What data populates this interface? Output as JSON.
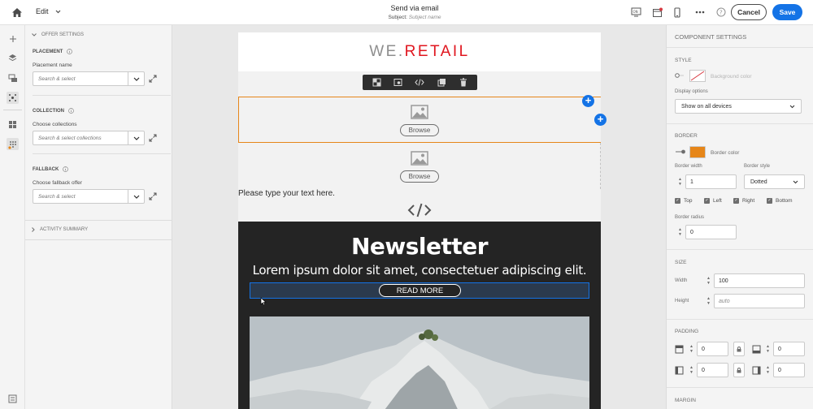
{
  "topbar": {
    "edit_label": "Edit",
    "title": "Send via email",
    "subject_label": "Subject:",
    "subject_placeholder": "Subject name",
    "cancel_label": "Cancel",
    "save_label": "Save",
    "accent": "#1473e6"
  },
  "rail": {
    "icons": [
      "add-icon",
      "layers-icon",
      "fragments-icon",
      "assets-icon",
      "components-icon",
      "offers-icon",
      "settings-bottom-icon"
    ]
  },
  "left_panel": {
    "offer_settings": "OFFER SETTINGS",
    "placement": {
      "heading": "PLACEMENT",
      "label": "Placement name",
      "placeholder": "Search & select"
    },
    "collection": {
      "heading": "COLLECTION",
      "label": "Choose collections",
      "placeholder": "Search & select collections"
    },
    "fallback": {
      "heading": "FALLBACK",
      "label": "Choose fallback offer",
      "placeholder": "Search & select"
    },
    "activity_summary": "ACTIVITY SUMMARY"
  },
  "email": {
    "logo_left": "WE.",
    "logo_right": "RETAIL",
    "browse_label": "Browse",
    "text_placeholder": "Please type your text here.",
    "newsletter_title": "Newsletter",
    "newsletter_subtitle": "Lorem ipsum dolor sit amet, consectetuer adipiscing elit.",
    "read_more": "READ MORE",
    "toolbar_icons": [
      "select-parent-icon",
      "personalize-icon",
      "code-icon",
      "duplicate-icon",
      "delete-icon"
    ]
  },
  "right_panel": {
    "title": "COMPONENT SETTINGS",
    "style": {
      "heading": "STYLE",
      "background_color_label": "Background color",
      "display_options_label": "Display options",
      "display_options_value": "Show on all devices"
    },
    "border": {
      "heading": "BORDER",
      "border_color_label": "Border color",
      "border_color": "#e68619",
      "width_label": "Border width",
      "width_value": "1",
      "style_label": "Border style",
      "style_value": "Dotted",
      "sides": [
        "Top",
        "Left",
        "Right",
        "Bottom"
      ],
      "radius_label": "Border radius",
      "radius_value": "0"
    },
    "size": {
      "heading": "SIZE",
      "width_label": "Width",
      "width_value": "100",
      "height_label": "Height",
      "height_placeholder": "auto"
    },
    "padding": {
      "heading": "PADDING",
      "top": "0",
      "bottom": "0",
      "left": "0",
      "right": "0"
    },
    "margin": {
      "heading": "MARGIN"
    }
  }
}
